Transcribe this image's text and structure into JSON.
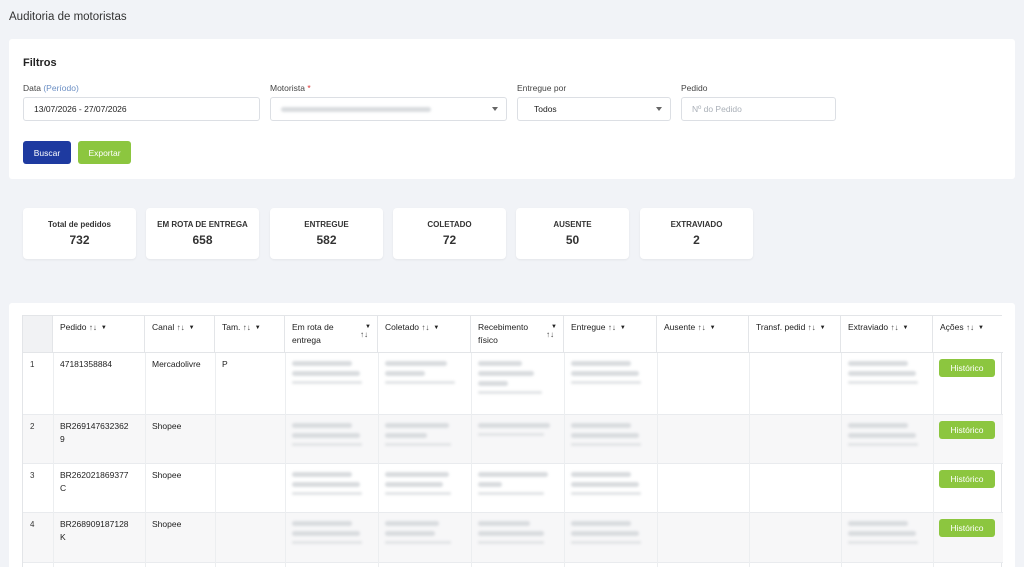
{
  "page": {
    "title": "Auditoria de motoristas"
  },
  "filters": {
    "title": "Filtros",
    "data_label": "Data",
    "data_hint": "(Período)",
    "data_value": "13/07/2026 - 27/07/2026",
    "motorista_label": "Motorista",
    "motorista_required": "*",
    "entregue_label": "Entregue por",
    "entregue_value": "Todos",
    "pedido_label": "Pedido",
    "pedido_placeholder": "Nº do Pedido",
    "buscar_label": "Buscar",
    "exportar_label": "Exportar"
  },
  "stats": [
    {
      "label": "Total de pedidos",
      "value": "732"
    },
    {
      "label": "EM ROTA DE ENTREGA",
      "value": "658"
    },
    {
      "label": "ENTREGUE",
      "value": "582"
    },
    {
      "label": "COLETADO",
      "value": "72"
    },
    {
      "label": "AUSENTE",
      "value": "50"
    },
    {
      "label": "EXTRAVIADO",
      "value": "2"
    }
  ],
  "table": {
    "headers": {
      "pedido": "Pedido",
      "canal": "Canal",
      "tam": "Tam.",
      "em_rota_line1": "Em rota de",
      "em_rota_line2": "entrega",
      "coletado": "Coletado",
      "recebimento_line1": "Recebimento",
      "recebimento_line2": "físico",
      "entregue": "Entregue",
      "ausente": "Ausente",
      "transf": "Transf. pedid",
      "extraviado": "Extraviado",
      "acoes": "Ações"
    },
    "sort_glyph": "↑↓",
    "filter_glyph": "▼",
    "history_label": "Histórico",
    "rows": [
      {
        "num": "1",
        "pedido_l1": "47181358884",
        "pedido_l2": "",
        "canal": "Mercadolivre",
        "tam": "P"
      },
      {
        "num": "2",
        "pedido_l1": "BR269147632362",
        "pedido_l2": "9",
        "canal": "Shopee",
        "tam": ""
      },
      {
        "num": "3",
        "pedido_l1": "BR262021869377",
        "pedido_l2": "C",
        "canal": "Shopee",
        "tam": ""
      },
      {
        "num": "4",
        "pedido_l1": "BR268909187128",
        "pedido_l2": "K",
        "canal": "Shopee",
        "tam": ""
      }
    ]
  }
}
